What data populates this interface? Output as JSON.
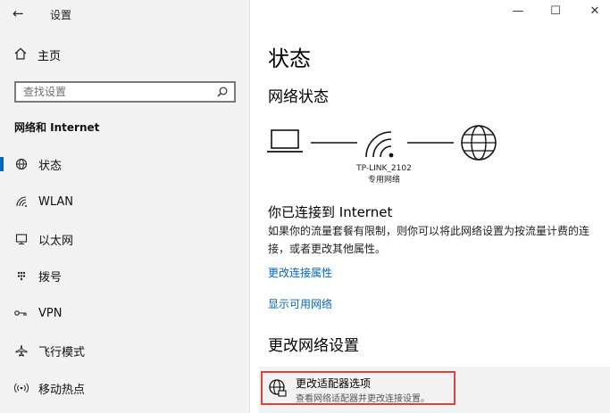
{
  "window": {
    "title": "设置",
    "back_glyph": "←",
    "minimize_glyph": "—",
    "maximize_glyph": "☐",
    "close_glyph": "✕"
  },
  "sidebar": {
    "home_label": "主页",
    "search_placeholder": "查找设置",
    "section_title": "网络和 Internet",
    "items": [
      {
        "label": "状态",
        "icon": "globe-status-icon",
        "active": true
      },
      {
        "label": "WLAN",
        "icon": "wifi-icon",
        "active": false
      },
      {
        "label": "以太网",
        "icon": "ethernet-icon",
        "active": false
      },
      {
        "label": "拨号",
        "icon": "dialup-icon",
        "active": false
      },
      {
        "label": "VPN",
        "icon": "vpn-icon",
        "active": false
      },
      {
        "label": "飞行模式",
        "icon": "airplane-icon",
        "active": false
      },
      {
        "label": "移动热点",
        "icon": "hotspot-icon",
        "active": false
      }
    ]
  },
  "main": {
    "page_title": "状态",
    "network_status_heading": "网络状态",
    "network_name": "TP-LINK_2102",
    "network_type": "专用网络",
    "connected_title": "你已连接到 Internet",
    "connected_desc": "如果你的流量套餐有限制，则你可以将此网络设置为按流量计费的连接，或者更改其他属性。",
    "link_change_props": "更改连接属性",
    "link_show_networks": "显示可用网络",
    "change_settings_heading": "更改网络设置",
    "adapter_title": "更改适配器选项",
    "adapter_subtitle": "查看网络适配器并更改连接设置。"
  },
  "colors": {
    "accent": "#0067c0",
    "highlight_box": "#d9453b",
    "sidebar_bg": "#f2f2f2"
  }
}
